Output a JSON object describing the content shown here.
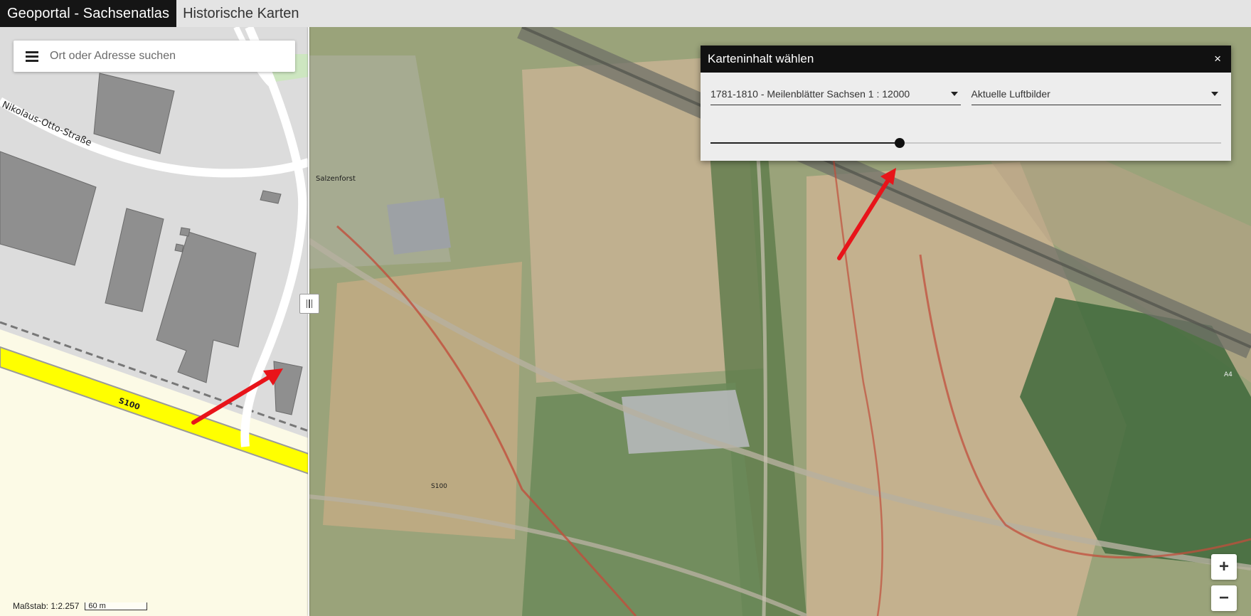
{
  "header": {
    "brand": "Geoportal - Sachsenatlas",
    "nav_item": "Historische Karten"
  },
  "search": {
    "menu_icon": "menu-icon",
    "placeholder": "Ort oder Adresse suchen"
  },
  "map_left": {
    "street_label": "Nikolaus-Otto-Straße",
    "road_label": "S100"
  },
  "map_right": {
    "place_label": "Salzenforst",
    "road_label": "S100",
    "motorway_label": "A4"
  },
  "layer_panel": {
    "title": "Karteninhalt wählen",
    "close_label": "×",
    "historic_layer": "1781-1810 - Meilenblätter Sachsen 1 : 12000",
    "current_layer": "Aktuelle Luftbilder",
    "opacity_fraction": 0.37
  },
  "zoom": {
    "in_label": "+",
    "out_label": "−"
  },
  "scale": {
    "label": "Maßstab: 1:2.257",
    "bar_label": "60 m"
  },
  "colors": {
    "header_dark": "#151515",
    "road_yellow": "#ffff00",
    "arrow_red": "#e8141a"
  }
}
